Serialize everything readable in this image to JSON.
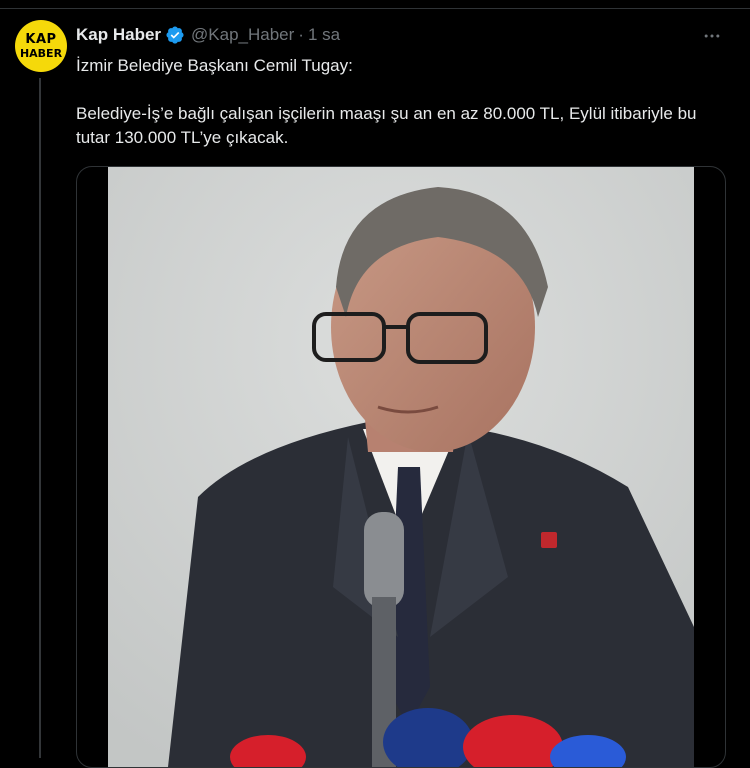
{
  "post": {
    "author_name": "Kap Haber",
    "handle": "@Kap_Haber",
    "separator": "·",
    "time": "1 sa",
    "text_line1": "İzmir Belediye Başkanı Cemil Tugay:",
    "text_line2": "Belediye-İş’e bağlı çalışan işçilerin maaşı şu an en az 80.000 TL, Eylül itibariyle bu tutar 130.000 TL’ye çıkacak.",
    "avatar_text_top": "KAP",
    "avatar_text_bottom": "HABER"
  },
  "icons": {
    "verified": "verified-badge-icon",
    "more": "more-options-icon"
  },
  "colors": {
    "background": "#000000",
    "text": "#e7e9ea",
    "secondary": "#71767b",
    "verified": "#1d9bf0",
    "avatar": "#f5d90a"
  }
}
